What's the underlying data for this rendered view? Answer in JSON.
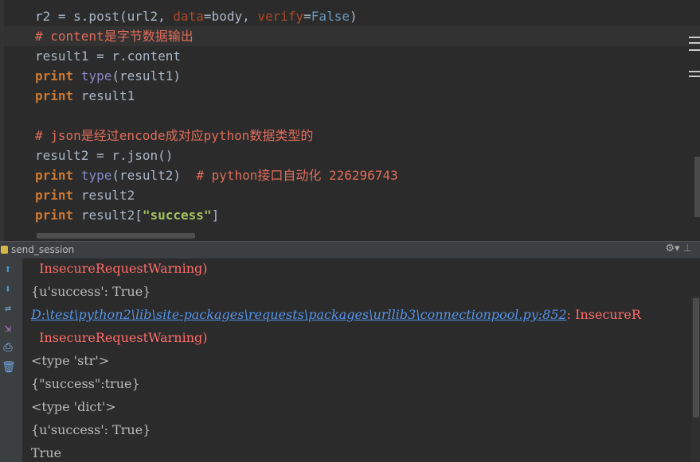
{
  "editor": {
    "line1": {
      "a": "r2 = s.post(url2, ",
      "kw1": "data",
      "b": "=body, ",
      "kw2": "verify",
      "c": "=",
      "bool": "False",
      "d": ")"
    },
    "line2": {
      "comment": "# content是字节数据输出"
    },
    "line3": {
      "text": "result1 = r.content"
    },
    "line4": {
      "kw": "print",
      "builtin": "type",
      "rest": "(result1)"
    },
    "line5": {
      "kw": "print",
      "rest": "result1"
    },
    "line6": {
      "comment": "# json是经过encode成对应python数据类型的"
    },
    "line7": {
      "text": "result2 = r.json()"
    },
    "line8": {
      "kw": "print",
      "builtin": "type",
      "rest": "(result2)  ",
      "comment": "# python接口自动化 226296743"
    },
    "line9": {
      "kw": "print",
      "rest": "result2"
    },
    "line10": {
      "kw": "print",
      "a": "result2[",
      "str": "\"success\"",
      "b": "]"
    }
  },
  "run_panel": {
    "title": "send_session",
    "settings_icon": "gear-icon",
    "toolbar_icons": [
      "arrow-up-icon",
      "arrow-down-icon",
      "soft-wrap-icon",
      "scroll-to-end-icon",
      "print-icon",
      "trash-icon"
    ]
  },
  "console": {
    "lines": [
      {
        "text": "  InsecureRequestWarning)",
        "type": "error"
      },
      {
        "text": "{u'success': True}",
        "type": "normal"
      },
      {
        "link": "D:\\test\\python2\\lib\\site-packages\\requests\\packages\\urllib3\\connectionpool.py:852",
        "rest": ": InsecureR",
        "type": "link"
      },
      {
        "text": "  InsecureRequestWarning)",
        "type": "error"
      },
      {
        "text": "<type 'str'>",
        "type": "normal"
      },
      {
        "text": "{\"success\":true}",
        "type": "normal"
      },
      {
        "text": "<type 'dict'>",
        "type": "normal"
      },
      {
        "text": "{u'success': True}",
        "type": "normal"
      },
      {
        "text": "True",
        "type": "normal"
      }
    ]
  },
  "colors": {
    "editor_bg": "#2b2b2b",
    "keyword": "#cc7832",
    "comment": "#e06c5a",
    "error": "#ff6b68",
    "link": "#5394ec"
  }
}
